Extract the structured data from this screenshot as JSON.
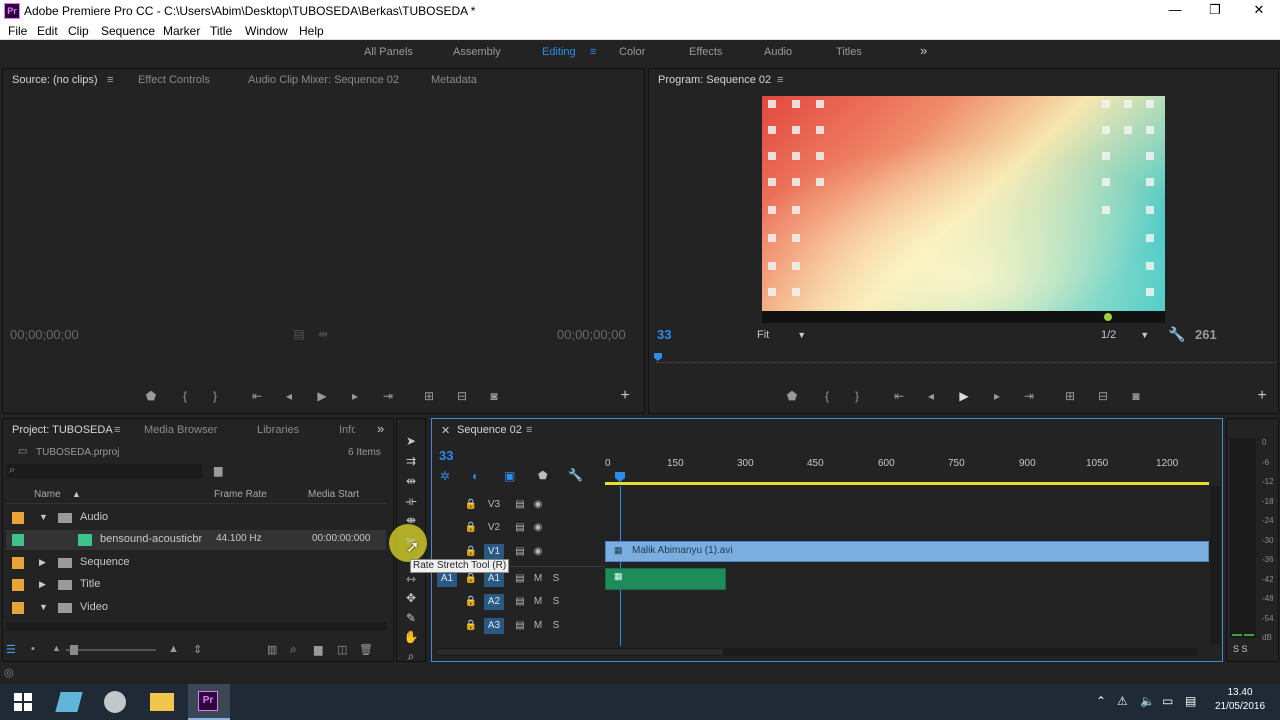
{
  "window": {
    "title": "Adobe Premiere Pro CC - C:\\Users\\Abim\\Desktop\\TUBOSEDA\\Berkas\\TUBOSEDA *",
    "app_icon": "Pr",
    "minimize": "—",
    "restore": "❐",
    "close": "✕"
  },
  "menu": [
    "File",
    "Edit",
    "Clip",
    "Sequence",
    "Marker",
    "Title",
    "Window",
    "Help"
  ],
  "workspaces": {
    "items": [
      "All Panels",
      "Assembly",
      "Editing",
      "Color",
      "Effects",
      "Audio",
      "Titles"
    ],
    "active": "Editing",
    "more": "»"
  },
  "source": {
    "tabs": [
      "Source: (no clips)",
      "Effect Controls",
      "Audio Clip Mixer: Sequence 02",
      "Metadata"
    ],
    "tc_left": "00;00;00;00",
    "tc_right": "00;00;00;00"
  },
  "program": {
    "tab": "Program: Sequence 02",
    "tc_left": "33",
    "fit": "Fit",
    "resolution": "1/2",
    "tc_right": "261"
  },
  "project": {
    "tabs": [
      "Project: TUBOSEDA",
      "Media Browser",
      "Libraries",
      "Info"
    ],
    "file": "TUBOSEDA.prproj",
    "items_count": "6 Items",
    "columns": [
      "Name",
      "Frame Rate",
      "Media Start"
    ],
    "rows": [
      {
        "name": "Audio",
        "type": "folder",
        "expanded": true,
        "color": "#e8a33a",
        "rate": "",
        "start": ""
      },
      {
        "name": "bensound-acousticbr",
        "type": "audio",
        "color": "#3dc48a",
        "rate": "44.100 Hz",
        "start": "00:00:00:000"
      },
      {
        "name": "Sequence",
        "type": "folder",
        "expanded": false,
        "color": "#e8a33a",
        "rate": "",
        "start": ""
      },
      {
        "name": "Title",
        "type": "folder",
        "expanded": false,
        "color": "#e8a33a",
        "rate": "",
        "start": ""
      },
      {
        "name": "Video",
        "type": "folder",
        "expanded": true,
        "color": "#e8a33a",
        "rate": "",
        "start": ""
      }
    ]
  },
  "tooltip": "Rate Stretch Tool (R)",
  "timeline": {
    "tab": "Sequence 02",
    "timecode": "33",
    "ruler": [
      "0",
      "150",
      "300",
      "450",
      "600",
      "750",
      "900",
      "1050",
      "1200"
    ],
    "video_tracks": [
      "V3",
      "V2",
      "V1"
    ],
    "audio_tracks": [
      "A1",
      "A2",
      "A3"
    ],
    "source_v": "V1",
    "source_a": "A1",
    "mute": "M",
    "solo": "S",
    "clip_video": "Malik Abimanyu (1).avi"
  },
  "meter": {
    "labels": [
      "0",
      "-6",
      "-12",
      "-18",
      "-24",
      "-30",
      "-36",
      "-42",
      "-48",
      "-54",
      "dB"
    ],
    "footer": "S S"
  },
  "taskbar": {
    "time": "13.40",
    "date": "21/05/2016"
  }
}
